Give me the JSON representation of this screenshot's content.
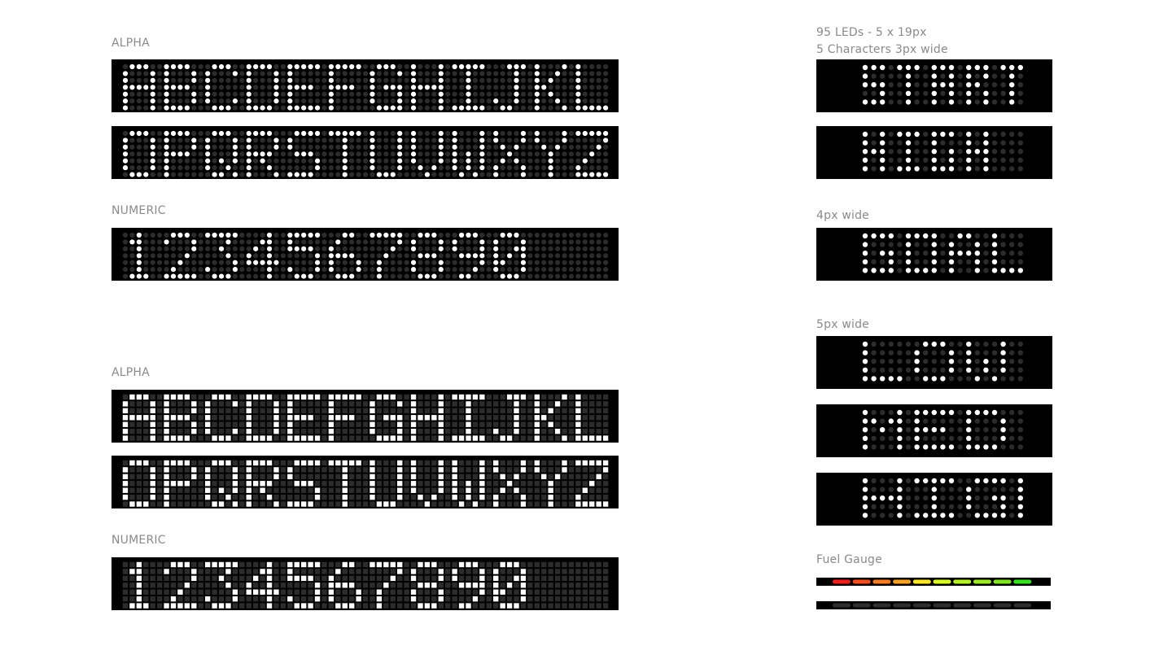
{
  "labels": {
    "alpha_dot": "ALPHA",
    "numeric_dot": "NUMERIC",
    "alpha_sq": "ALPHA",
    "numeric_sq": "NUMERIC",
    "leds_line1": "95 LEDs - 5 x 19px",
    "leds_line2": "5 Characters 3px wide",
    "w4": "4px wide",
    "w5": "5px wide",
    "fuel": "Fuel Gauge"
  },
  "displays": {
    "alpha_row1": "ABCDEFGHIJKLMN",
    "alpha_row2": "OPQRSTUVWXYZ-!",
    "numeric": "1234567890",
    "w3_a": "START",
    "w3_b": "HIGH",
    "w4_a": "GOAL",
    "w5_a": "LOW",
    "w5_b": "MED",
    "w5_c": "HIGH"
  },
  "fuel_gauge": {
    "lit_colors": [
      "#ff1a1a",
      "#ff4a1a",
      "#ff7a1a",
      "#ffa01a",
      "#ffe81a",
      "#d8ff1a",
      "#b6f51a",
      "#9cec1a",
      "#7ee81a",
      "#2ee81a"
    ],
    "off_color": "#2e2e2e"
  }
}
